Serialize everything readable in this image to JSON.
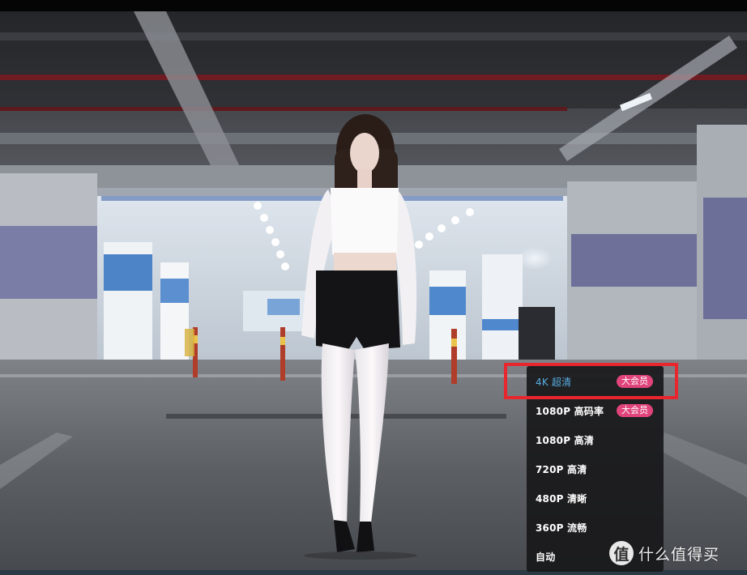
{
  "player": {
    "quality_menu": {
      "options": [
        {
          "label": "4K 超清",
          "badge": "大会员",
          "selected": true
        },
        {
          "label": "1080P 高码率",
          "badge": "大会员",
          "selected": false
        },
        {
          "label": "1080P 高清",
          "badge": "",
          "selected": false
        },
        {
          "label": "720P 高清",
          "badge": "",
          "selected": false
        },
        {
          "label": "480P 清晰",
          "badge": "",
          "selected": false
        },
        {
          "label": "360P 流畅",
          "badge": "",
          "selected": false
        },
        {
          "label": "自动",
          "badge": "",
          "selected": false
        }
      ]
    },
    "highlight_color": "#e8262d",
    "selected_color": "#5aaee4",
    "badge_color": "#e0447a"
  },
  "watermark": {
    "logo_glyph": "值",
    "text": "什么值得买"
  }
}
